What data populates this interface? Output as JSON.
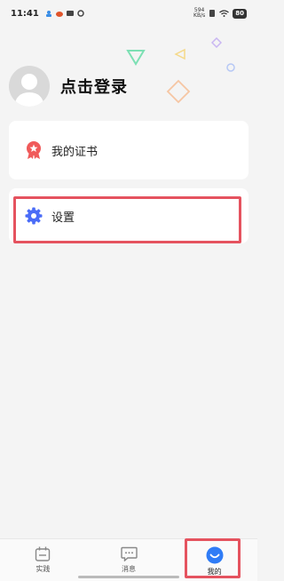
{
  "status_bar": {
    "time": "11:41",
    "net_speed_value": "594",
    "net_speed_unit": "KB/s",
    "battery": "80"
  },
  "profile": {
    "login_text": "点击登录"
  },
  "menu": {
    "certificate_label": "我的证书",
    "settings_label": "设置"
  },
  "tabs": [
    {
      "label": "实践",
      "icon": "calendar-icon"
    },
    {
      "label": "消息",
      "icon": "chat-icon"
    },
    {
      "label": "我的",
      "icon": "smile-icon"
    }
  ],
  "colors": {
    "accent_blue": "#2f7cf6",
    "highlight_red": "#e5535f",
    "certificate_red": "#f05a5a",
    "settings_blue": "#4a6cf7"
  }
}
